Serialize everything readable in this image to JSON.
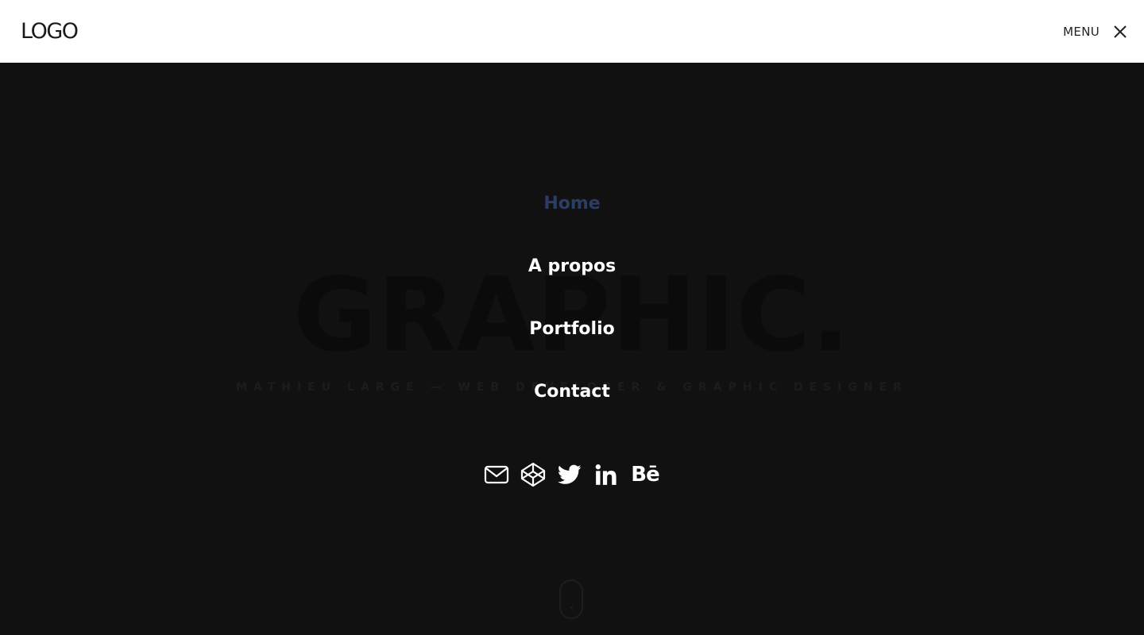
{
  "header": {
    "logo": "LOGO",
    "menu_label": "MENU",
    "close_icon": "close-icon"
  },
  "hero": {
    "title": "GRAPHIC.",
    "subtitle": "MATHIEU LARGE — WEB DEVELOPER & GRAPHIC DESIGNER"
  },
  "nav": {
    "items": [
      {
        "label": "Home",
        "active": true
      },
      {
        "label": "A propos",
        "active": false
      },
      {
        "label": "Portfolio",
        "active": false
      },
      {
        "label": "Contact",
        "active": false
      }
    ]
  },
  "socials": [
    {
      "icon": "mail-icon"
    },
    {
      "icon": "codepen-icon"
    },
    {
      "icon": "twitter-icon"
    },
    {
      "icon": "linkedin-icon"
    },
    {
      "icon": "behance-icon",
      "text": "Bē"
    }
  ],
  "colors": {
    "background": "#111111",
    "header": "#ffffff",
    "active": "#2c3d63",
    "link": "#ffffff"
  }
}
